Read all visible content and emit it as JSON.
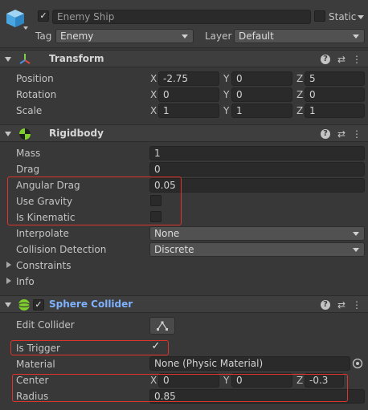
{
  "go": {
    "active": true,
    "name": "Enemy Ship",
    "static_label": "Static",
    "static": false,
    "tag_label": "Tag",
    "tag": "Enemy",
    "layer_label": "Layer",
    "layer": "Default"
  },
  "transform": {
    "title": "Transform",
    "position_label": "Position",
    "rotation_label": "Rotation",
    "scale_label": "Scale",
    "x": "X",
    "y": "Y",
    "z": "Z",
    "position": [
      "-2.75",
      "0",
      "5"
    ],
    "rotation": [
      "0",
      "0",
      "0"
    ],
    "scale": [
      "1",
      "1",
      "1"
    ]
  },
  "rigidbody": {
    "title": "Rigidbody",
    "mass_label": "Mass",
    "mass": "1",
    "drag_label": "Drag",
    "drag": "0",
    "angular_drag_label": "Angular Drag",
    "angular_drag": "0.05",
    "use_gravity_label": "Use Gravity",
    "use_gravity": false,
    "is_kinematic_label": "Is Kinematic",
    "is_kinematic": false,
    "interpolate_label": "Interpolate",
    "interpolate": "None",
    "collision_label": "Collision Detection",
    "collision": "Discrete",
    "constraints_label": "Constraints",
    "info_label": "Info"
  },
  "sphere": {
    "title": "Sphere Collider",
    "enabled": true,
    "edit_label": "Edit Collider",
    "is_trigger_label": "Is Trigger",
    "is_trigger": true,
    "material_label": "Material",
    "material": "None (Physic Material)",
    "center_label": "Center",
    "x": "X",
    "y": "Y",
    "z": "Z",
    "center": [
      "0",
      "0",
      "-0.3"
    ],
    "radius_label": "Radius",
    "radius": "0.85"
  },
  "colors": {
    "highlight": "#e0332b",
    "accent_title": "#7fb2ff",
    "panel": "#383838"
  }
}
